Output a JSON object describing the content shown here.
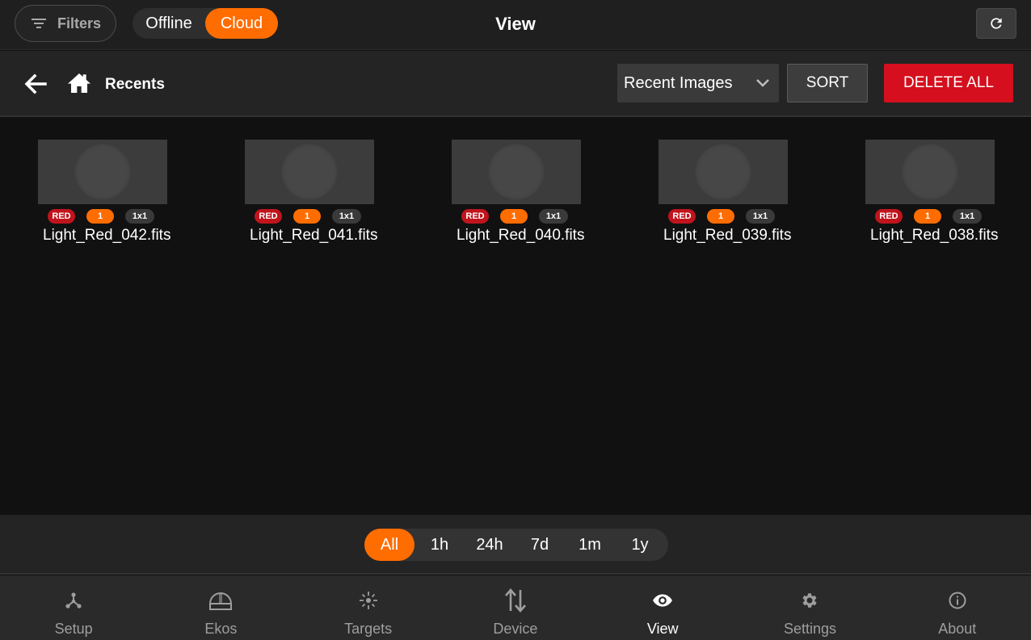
{
  "header": {
    "filters_label": "Filters",
    "mode_offline": "Offline",
    "mode_cloud": "Cloud",
    "title": "View"
  },
  "toolbar": {
    "breadcrumb": "Recents",
    "sort_select_value": "Recent Images",
    "sort_label": "SORT",
    "delete_all_label": "DELETE ALL"
  },
  "images": [
    {
      "filter": "RED",
      "count": "1",
      "binning": "1x1",
      "name": "Light_Red_042.fits"
    },
    {
      "filter": "RED",
      "count": "1",
      "binning": "1x1",
      "name": "Light_Red_041.fits"
    },
    {
      "filter": "RED",
      "count": "1",
      "binning": "1x1",
      "name": "Light_Red_040.fits"
    },
    {
      "filter": "RED",
      "count": "1",
      "binning": "1x1",
      "name": "Light_Red_039.fits"
    },
    {
      "filter": "RED",
      "count": "1",
      "binning": "1x1",
      "name": "Light_Red_038.fits"
    }
  ],
  "time_range": {
    "options": [
      "All",
      "1h",
      "24h",
      "7d",
      "1m",
      "1y"
    ],
    "selected": "All"
  },
  "nav": {
    "items": [
      {
        "label": "Setup",
        "icon": "setup-icon"
      },
      {
        "label": "Ekos",
        "icon": "ekos-icon"
      },
      {
        "label": "Targets",
        "icon": "targets-icon"
      },
      {
        "label": "Device",
        "icon": "device-icon"
      },
      {
        "label": "View",
        "icon": "eye-icon"
      },
      {
        "label": "Settings",
        "icon": "gear-icon"
      },
      {
        "label": "About",
        "icon": "info-icon"
      }
    ],
    "active": "View"
  },
  "colors": {
    "accent": "#ff6d00",
    "danger": "#d50f1d",
    "background": "#111111",
    "bar": "#242424"
  }
}
